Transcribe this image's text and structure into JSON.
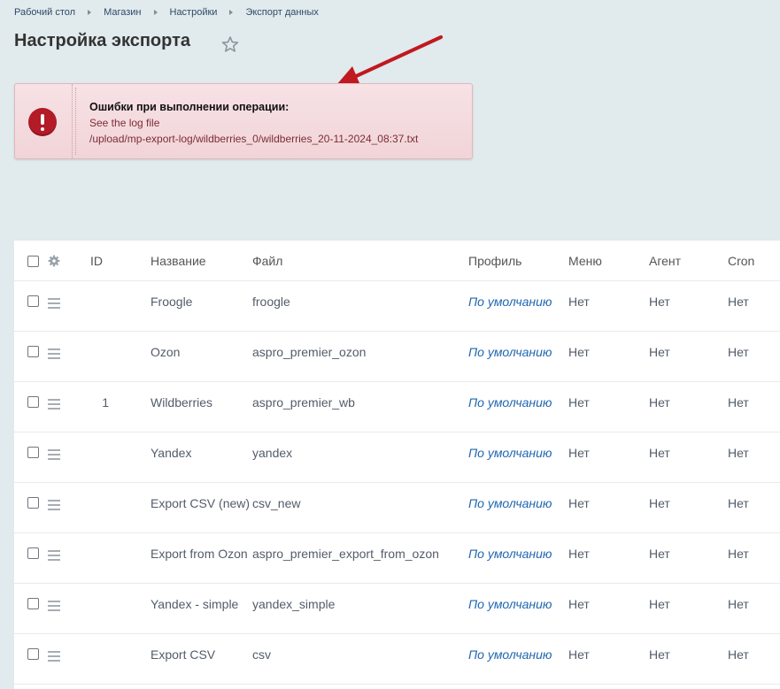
{
  "breadcrumb": [
    "Рабочий стол",
    "Магазин",
    "Настройки",
    "Экспорт данных"
  ],
  "page_title": "Настройка экспорта",
  "alert": {
    "title": "Ошибки при выполнении операции:",
    "line1": "See the log file",
    "line2": "/upload/mp-export-log/wildberries_0/wildberries_20-11-2024_08:37.txt"
  },
  "table": {
    "headers": {
      "id": "ID",
      "name": "Название",
      "file": "Файл",
      "profile": "Профиль",
      "menu": "Меню",
      "agent": "Агент",
      "cron": "Cron"
    },
    "rows": [
      {
        "id": "",
        "name": "Froogle",
        "file": "froogle",
        "profile": "По умолчанию",
        "menu": "Нет",
        "agent": "Нет",
        "cron": "Нет"
      },
      {
        "id": "",
        "name": "Ozon",
        "file": "aspro_premier_ozon",
        "profile": "По умолчанию",
        "menu": "Нет",
        "agent": "Нет",
        "cron": "Нет"
      },
      {
        "id": "1",
        "name": "Wildberries",
        "file": "aspro_premier_wb",
        "profile": "По умолчанию",
        "menu": "Нет",
        "agent": "Нет",
        "cron": "Нет"
      },
      {
        "id": "",
        "name": "Yandex",
        "file": "yandex",
        "profile": "По умолчанию",
        "menu": "Нет",
        "agent": "Нет",
        "cron": "Нет"
      },
      {
        "id": "",
        "name": "Export CSV (new)",
        "file": "csv_new",
        "profile": "По умолчанию",
        "menu": "Нет",
        "agent": "Нет",
        "cron": "Нет"
      },
      {
        "id": "",
        "name": "Export from Ozon",
        "file": "aspro_premier_export_from_ozon",
        "profile": "По умолчанию",
        "menu": "Нет",
        "agent": "Нет",
        "cron": "Нет"
      },
      {
        "id": "",
        "name": "Yandex - simple",
        "file": "yandex_simple",
        "profile": "По умолчанию",
        "menu": "Нет",
        "agent": "Нет",
        "cron": "Нет"
      },
      {
        "id": "",
        "name": "Export CSV",
        "file": "csv",
        "profile": "По умолчанию",
        "menu": "Нет",
        "agent": "Нет",
        "cron": "Нет"
      }
    ]
  },
  "icons": [
    "star-icon",
    "error-icon",
    "gear-icon",
    "drag-handle-icon",
    "annotation-arrow"
  ],
  "colors": {
    "background": "#e1eaec",
    "alert_bg": "#f4dbdf",
    "error_red": "#b31b27",
    "link_blue": "#2067b0",
    "arrow_red": "#c0191f"
  }
}
